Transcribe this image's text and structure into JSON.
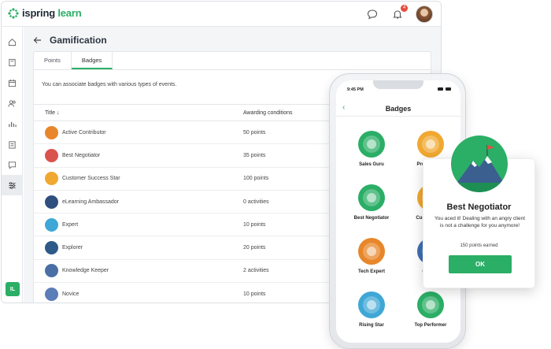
{
  "app": {
    "logo_brand": "ispring",
    "logo_product": "learn",
    "notification_count": "4",
    "user_initials": "IL"
  },
  "page": {
    "title": "Gamification",
    "description": "You can associate badges with various types of events."
  },
  "tabs": [
    {
      "label": "Points"
    },
    {
      "label": "Badges"
    }
  ],
  "table": {
    "headers": {
      "title": "Title ↓",
      "conditions": "Awarding conditions"
    },
    "rows": [
      {
        "name": "Active Contributor",
        "condition": "50 points",
        "color": "#e8862a"
      },
      {
        "name": "Best Negotiator",
        "condition": "35 points",
        "color": "#d9534f"
      },
      {
        "name": "Customer Success Star",
        "condition": "100 points",
        "color": "#f0a830"
      },
      {
        "name": "eLearning Ambassador",
        "condition": "0 activities",
        "color": "#2f4f7f"
      },
      {
        "name": "Expert",
        "condition": "10 points",
        "color": "#3fa7d6"
      },
      {
        "name": "Explorer",
        "condition": "20 points",
        "color": "#2d5a88"
      },
      {
        "name": "Knowledge Keeper",
        "condition": "2 activities",
        "color": "#4a6fa5"
      },
      {
        "name": "Novice",
        "condition": "10 points",
        "color": "#5b7db8"
      }
    ]
  },
  "phone": {
    "time": "9:45 PM",
    "title": "Badges",
    "back": "‹",
    "badges": [
      {
        "label": "Sales Guru",
        "color": "#2bae66"
      },
      {
        "label": "Prese… Exp",
        "color": "#f0a830"
      },
      {
        "label": "Best Negotiator",
        "color": "#2bae66"
      },
      {
        "label": "Custom… Ex",
        "color": "#f0a830"
      },
      {
        "label": "Tech Expert",
        "color": "#e8862a"
      },
      {
        "label": "Great S",
        "color": "#3f6fb5"
      },
      {
        "label": "Rising Star",
        "color": "#3fa7d6"
      },
      {
        "label": "Top Performer",
        "color": "#2bae66"
      }
    ]
  },
  "popup": {
    "title": "Best Negotiator",
    "message": "You aced it! Dealing with an angry client is not a challenge for you anymore!",
    "points": "150 points earned",
    "ok_label": "OK"
  },
  "colors": {
    "accent": "#2bae66",
    "badge_red": "#e74c3c"
  }
}
